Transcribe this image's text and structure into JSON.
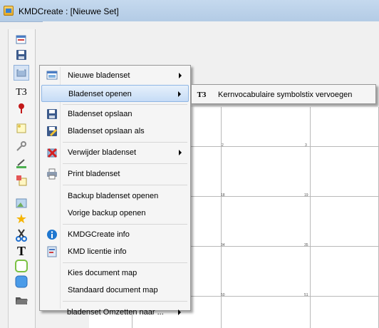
{
  "window": {
    "title": "KMDCreate : [Nieuwe Set]"
  },
  "toolbar": {
    "icons": [
      "new-set-icon",
      "save-icon",
      "open-set-icon",
      "t3-icon",
      "pin-icon",
      "note-icon",
      "key-icon",
      "edit-icon",
      "copy-icon",
      "image-icon",
      "star-icon",
      "scissors-icon",
      "text-icon",
      "rounded-frame-icon",
      "blue-frame-icon",
      "folder-icon"
    ],
    "t3_text": "T3",
    "text_tool": "T"
  },
  "menu": {
    "items": [
      {
        "label": "Nieuwe bladenset",
        "submenu": true,
        "icon": "new-set-icon"
      },
      {
        "label": "Bladenset openen",
        "submenu": true,
        "icon": "",
        "highlighted": true
      },
      {
        "label": "Bladenset opslaan",
        "submenu": false,
        "icon": "save-icon"
      },
      {
        "label": "Bladenset opslaan als",
        "submenu": false,
        "icon": "save-as-icon"
      },
      {
        "label": "Verwijder bladenset",
        "submenu": true,
        "icon": "delete-icon"
      },
      {
        "label": "Print bladenset",
        "submenu": false,
        "icon": "printer-icon"
      },
      {
        "label": "Backup bladenset openen",
        "submenu": false,
        "icon": ""
      },
      {
        "label": "Vorige backup openen",
        "submenu": false,
        "icon": ""
      },
      {
        "label": "KMDGCreate info",
        "submenu": false,
        "icon": "info-icon"
      },
      {
        "label": "KMD licentie info",
        "submenu": false,
        "icon": "license-icon"
      },
      {
        "label": "Kies document map",
        "submenu": false,
        "icon": ""
      },
      {
        "label": "Standaard document map",
        "submenu": false,
        "icon": ""
      },
      {
        "label": "bladenset Omzetten naar ...",
        "submenu": true,
        "icon": ""
      }
    ]
  },
  "submenu": {
    "items": [
      {
        "label": "Kernvocabulaire symbolstix vervoegen",
        "icon_text": "T3"
      }
    ]
  },
  "grid": {
    "cell_numbers": [
      "2",
      "3",
      "18",
      "19",
      "34",
      "35",
      "50",
      "51"
    ]
  },
  "colors": {
    "highlight": "#c6dcf6",
    "menu_bg": "#f5f5f5",
    "titlebar": "#c5d9ee"
  }
}
